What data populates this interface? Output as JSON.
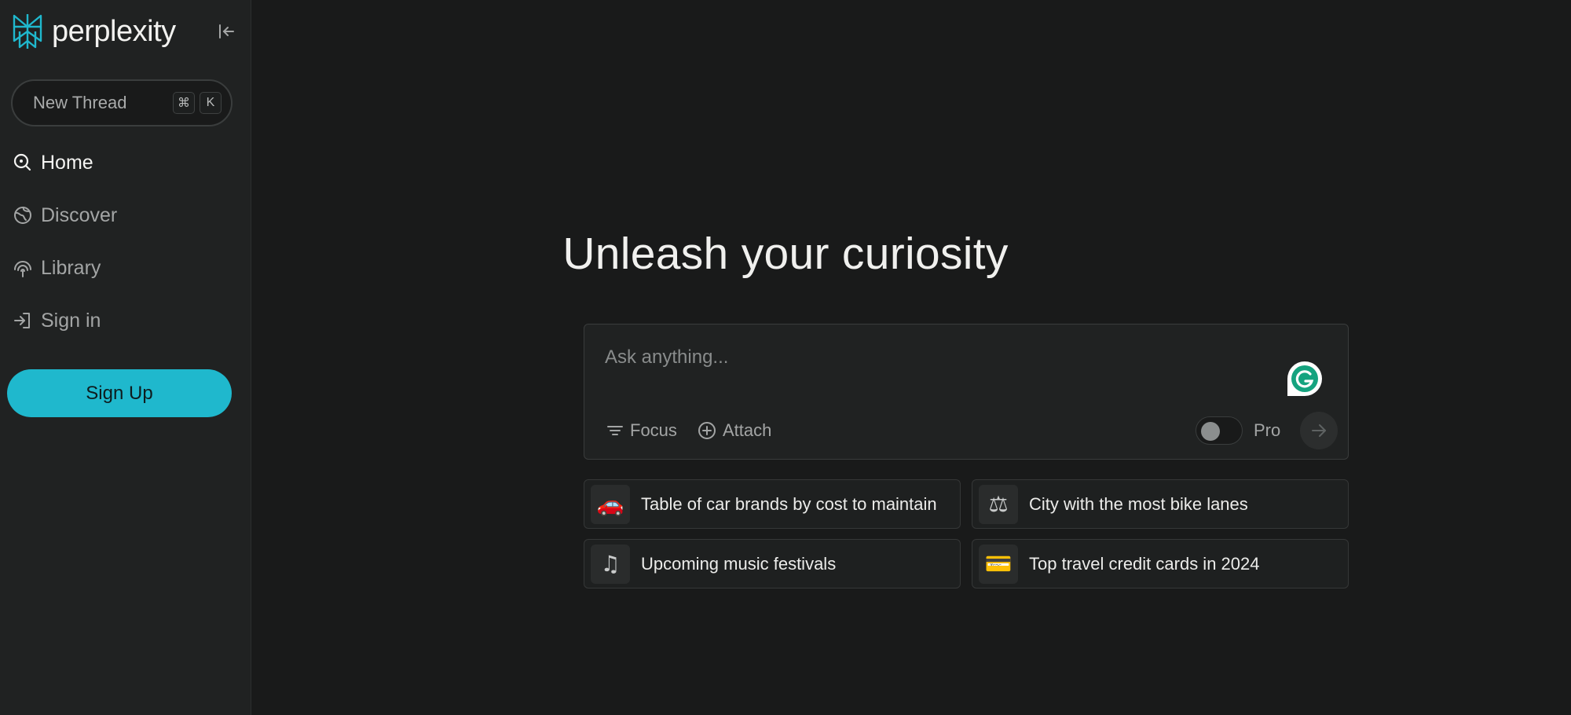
{
  "brand": {
    "name": "perplexity",
    "accent": "#1fb8cd"
  },
  "sidebar": {
    "new_thread": {
      "label": "New Thread",
      "shortcut_keys": [
        "⌘",
        "K"
      ]
    },
    "nav": [
      {
        "label": "Home",
        "icon": "search-icon",
        "active": true
      },
      {
        "label": "Discover",
        "icon": "globe-icon",
        "active": false
      },
      {
        "label": "Library",
        "icon": "library-icon",
        "active": false
      },
      {
        "label": "Sign in",
        "icon": "sign-in-icon",
        "active": false
      }
    ],
    "signup_label": "Sign Up"
  },
  "main": {
    "headline": "Unleash your curiosity",
    "ask": {
      "placeholder": "Ask anything...",
      "focus_label": "Focus",
      "attach_label": "Attach",
      "pro_label": "Pro",
      "pro_enabled": false
    },
    "suggestions": [
      {
        "icon": "🚗",
        "text": "Table of car brands by cost to maintain"
      },
      {
        "icon": "⚖",
        "text": "City with the most bike lanes"
      },
      {
        "icon": "♫",
        "text": "Upcoming music festivals"
      },
      {
        "icon": "💳",
        "text": "Top travel credit cards in 2024"
      }
    ]
  }
}
